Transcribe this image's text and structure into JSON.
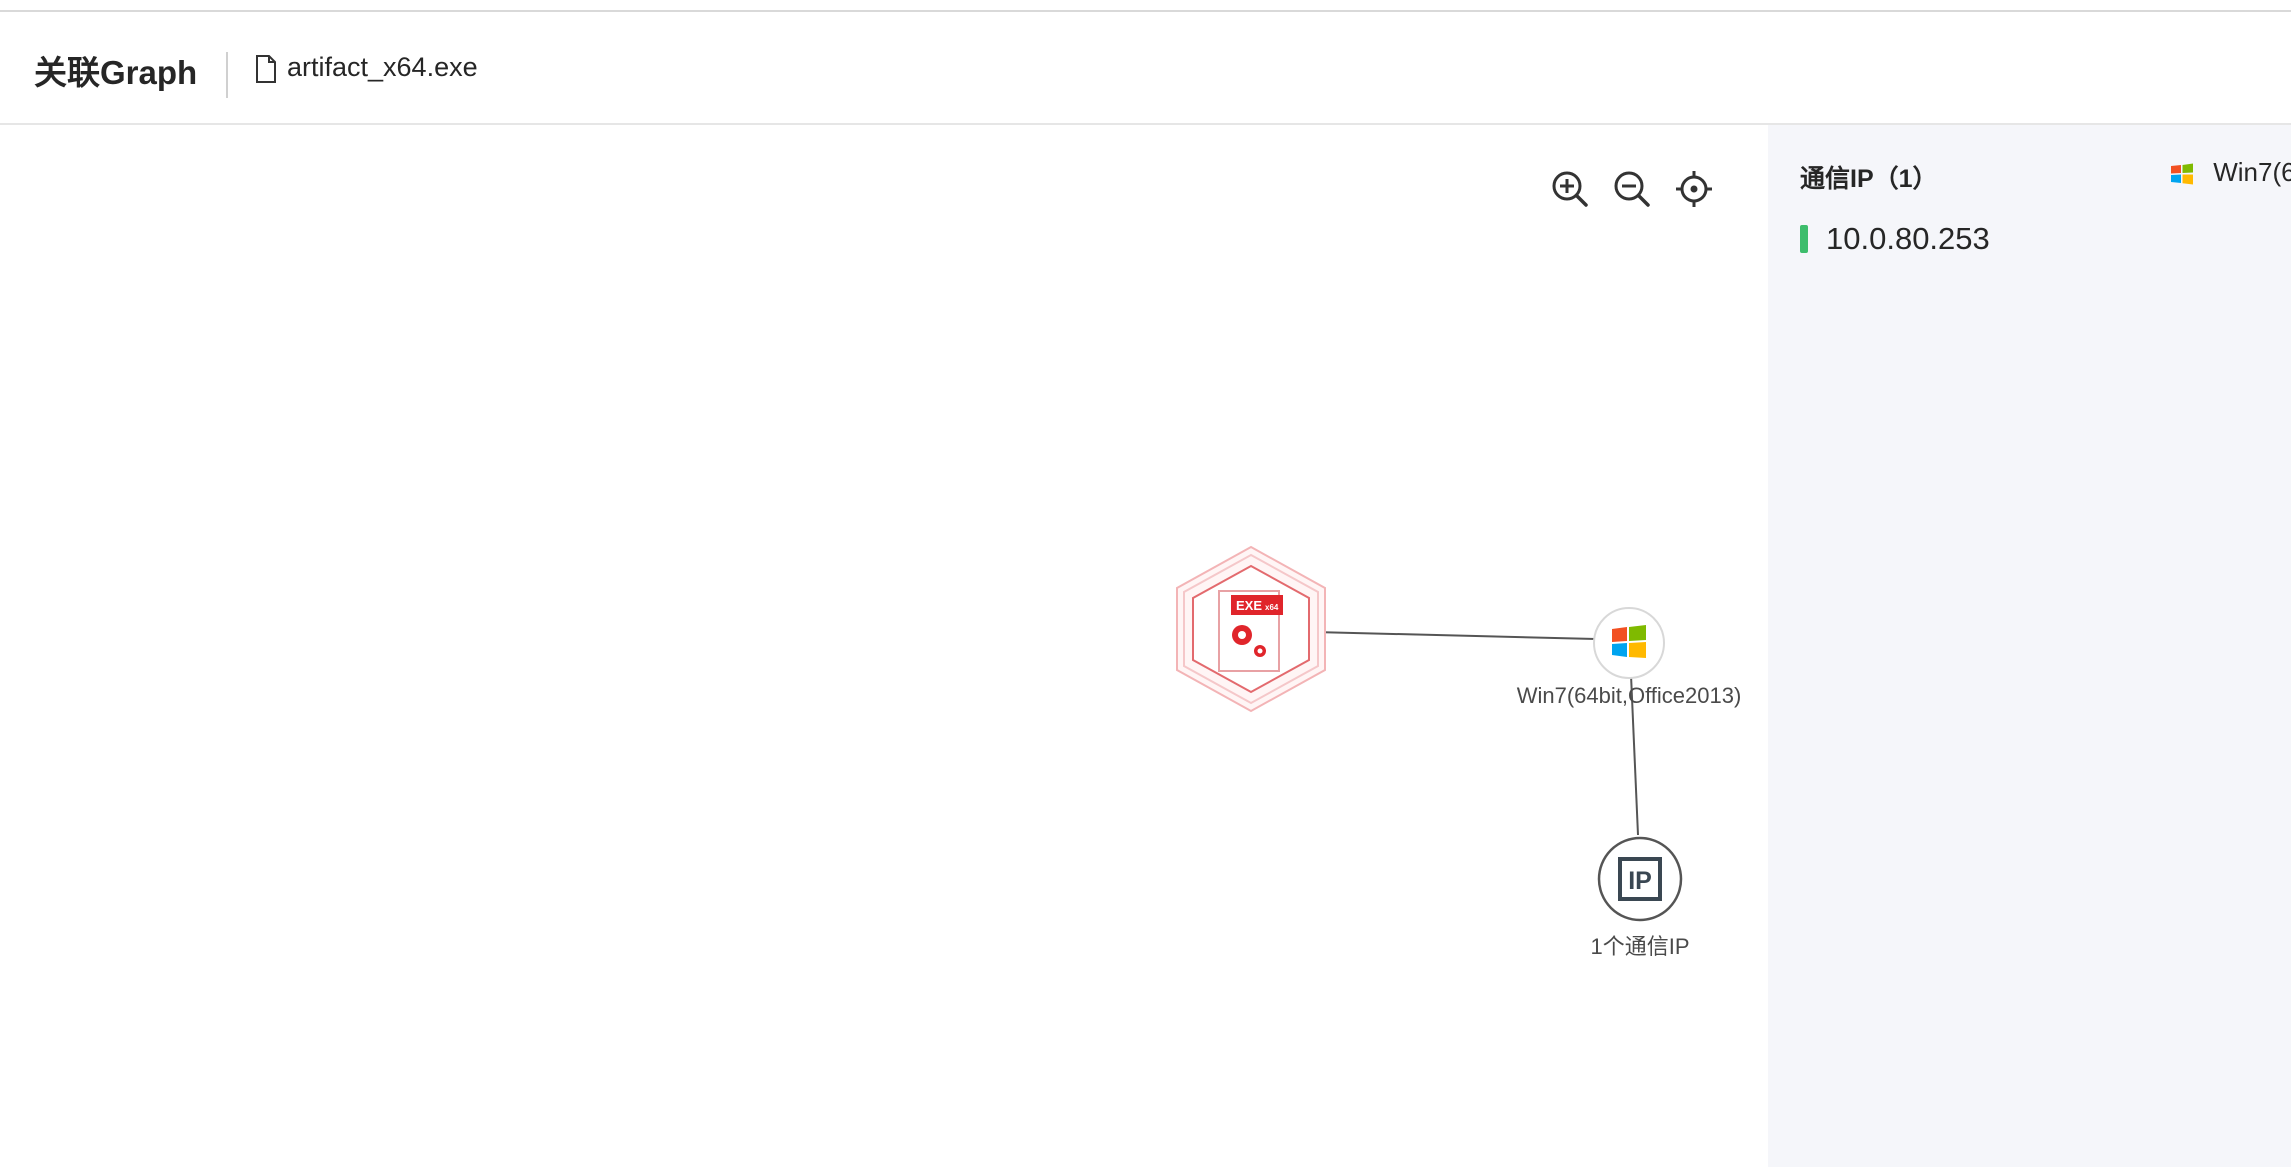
{
  "header": {
    "title": "关联Graph",
    "file_icon": "file-icon",
    "file_name": "artifact_x64.exe"
  },
  "toolbar": {
    "zoom_in_icon": "zoom-in-icon",
    "zoom_out_icon": "zoom-out-icon",
    "locate_icon": "locate-icon"
  },
  "graph": {
    "nodes": {
      "exe": {
        "badge_main": "EXE",
        "badge_sub": "x64",
        "icon": "exe-file-icon",
        "accent": "#e0252b"
      },
      "os": {
        "label": "Win7(64bit,Office2013)",
        "icon": "windows-logo-icon"
      },
      "ip": {
        "label": "1个通信IP",
        "glyph": "IP",
        "icon": "ip-icon"
      }
    }
  },
  "sidebar": {
    "section_title": "通信IP（1）",
    "os_tab_label": "Win7(6",
    "ips": [
      "10.0.80.253"
    ],
    "accent_color": "#3dbd6c"
  }
}
